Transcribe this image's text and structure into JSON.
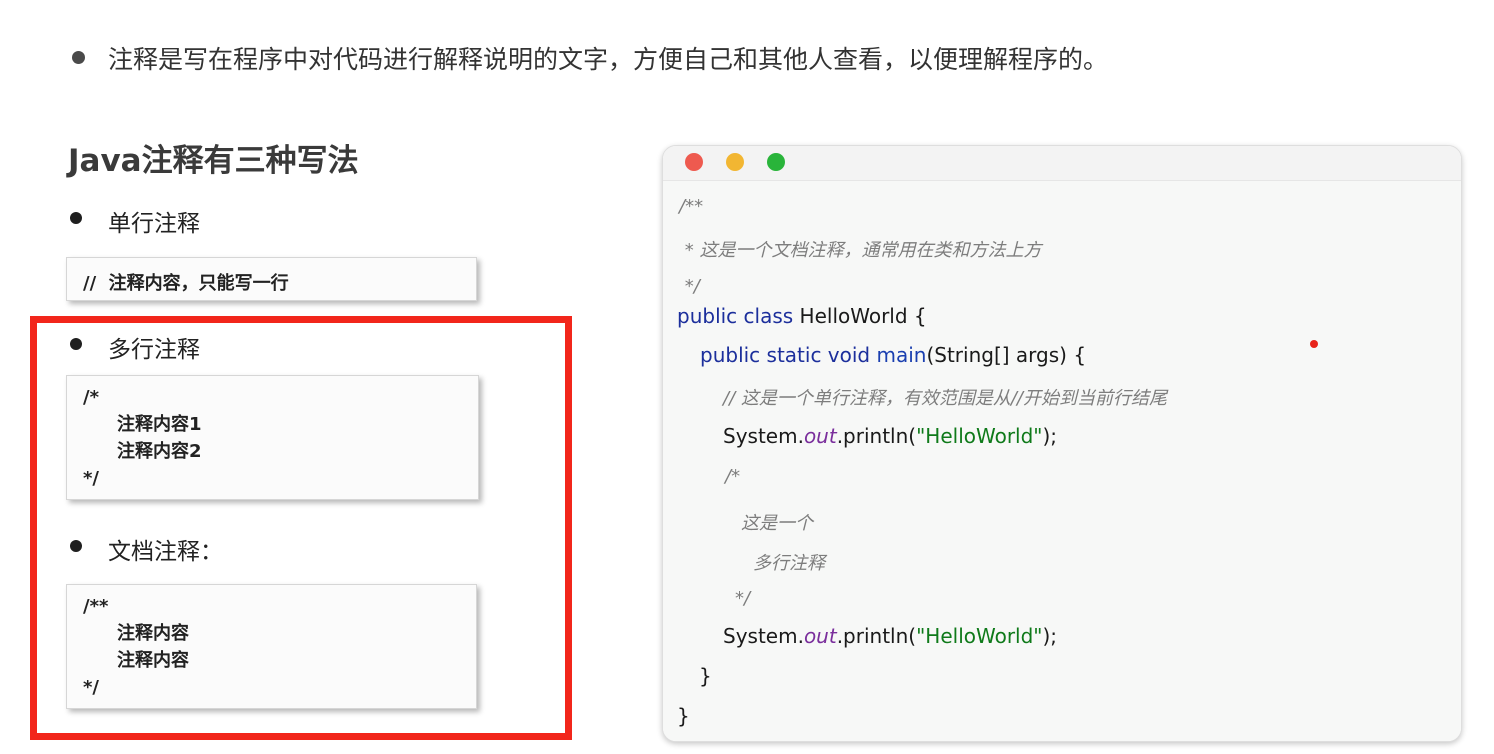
{
  "intro": "注释是写在程序中对代码进行解释说明的文字，方便自己和其他人查看，以便理解程序的。",
  "section_title": "Java注释有三种写法",
  "items": [
    {
      "label": "单行注释",
      "code": [
        "//  注释内容，只能写一行"
      ]
    },
    {
      "label": "多行注释",
      "code": [
        "/*",
        "注释内容1",
        "注释内容2",
        "*/"
      ]
    },
    {
      "label": "文档注释：",
      "code": [
        "/**",
        "注释内容",
        "注释内容",
        "*/"
      ]
    }
  ],
  "editor": {
    "traffic_lights": [
      "#ee5a4f",
      "#f2b632",
      "#29b43a"
    ],
    "code": {
      "l1": "/**",
      "l2": " * 这是一个文档注释，通常用在类和方法上方",
      "l3": " */",
      "l4_kw": "public class",
      "l4_name": " HelloWorld {",
      "l5_kw": "public static void",
      "l5_fn": " main",
      "l5_rest": "(String[] args) {",
      "l6": "// 这是一个单行注释，有效范围是从//开始到当前行结尾",
      "l7_a": "System.",
      "l7_field": "out",
      "l7_b": ".println(",
      "l7_str": "\"HelloWorld\"",
      "l7_c": ");",
      "l8": "/*",
      "l9": "这是一个",
      "l10": "多行注释",
      "l11": "*/",
      "l12_a": "System.",
      "l12_field": "out",
      "l12_b": ".println(",
      "l12_str": "\"HelloWorld\"",
      "l12_c": ");",
      "l13": "}",
      "l14": "}"
    }
  },
  "colors": {
    "highlight_frame": "#f2261b",
    "keyword": "#1c2f9c",
    "string": "#0f7a1a",
    "field": "#7a2e9c",
    "comment": "#7d7d7d"
  }
}
